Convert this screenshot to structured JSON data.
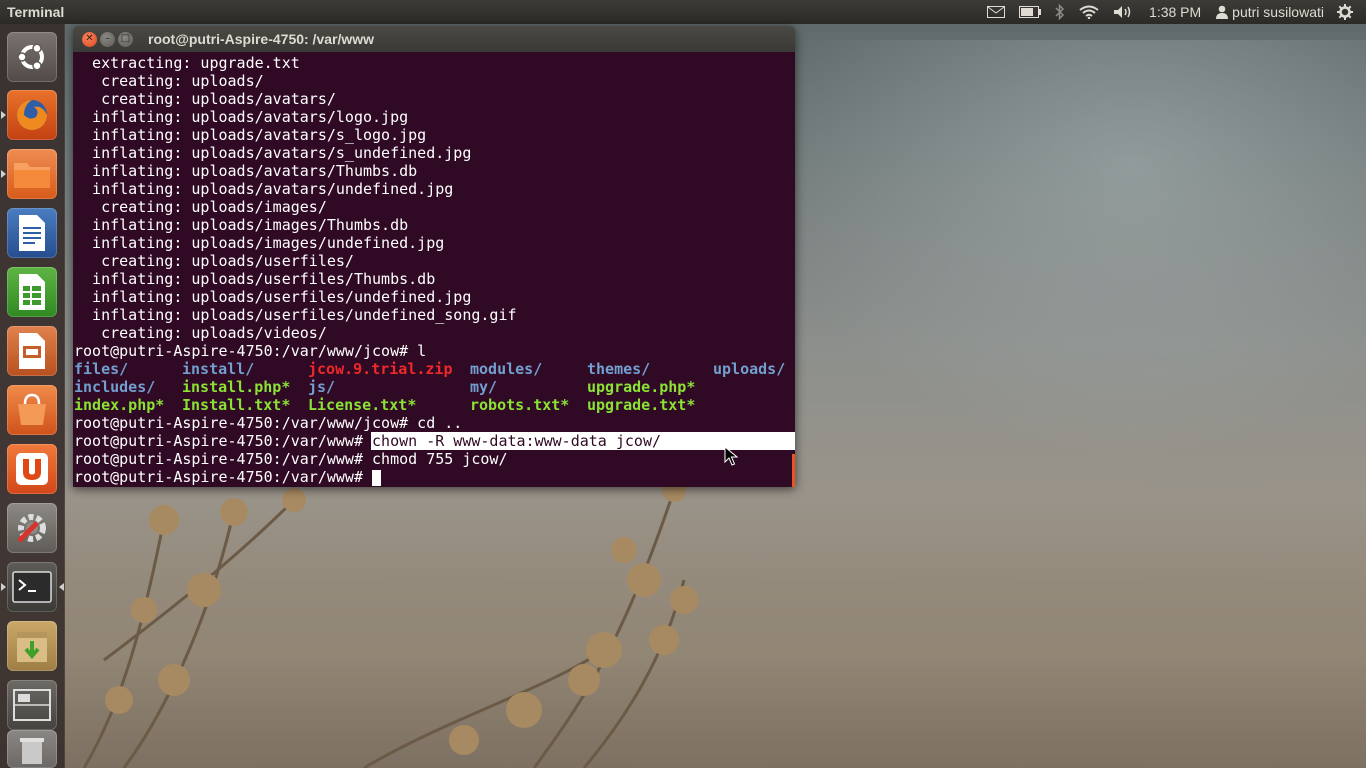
{
  "top_panel": {
    "app_title": "Terminal",
    "clock": "1:38 PM",
    "user_name": "putri susilowati"
  },
  "launcher": {
    "items": [
      {
        "name": "Dash home",
        "icon": "ubuntu-icon"
      },
      {
        "name": "Firefox",
        "icon": "firefox-icon"
      },
      {
        "name": "Files",
        "icon": "folder-icon"
      },
      {
        "name": "LibreOffice Writer",
        "icon": "writer-icon"
      },
      {
        "name": "LibreOffice Calc",
        "icon": "calc-icon"
      },
      {
        "name": "LibreOffice Impress",
        "icon": "impress-icon"
      },
      {
        "name": "Ubuntu Software Center",
        "icon": "software-center-icon"
      },
      {
        "name": "Ubuntu One",
        "icon": "ubuntu-one-icon"
      },
      {
        "name": "System Settings",
        "icon": "settings-icon"
      },
      {
        "name": "Terminal",
        "icon": "terminal-icon"
      },
      {
        "name": "Archive Manager",
        "icon": "archive-icon"
      },
      {
        "name": "Workspace Switcher",
        "icon": "workspace-icon"
      },
      {
        "name": "Trash",
        "icon": "trash-icon"
      }
    ]
  },
  "terminal": {
    "window_title": "root@putri-Aspire-4750: /var/www",
    "output_lines": [
      "  extracting: upgrade.txt",
      "   creating: uploads/",
      "   creating: uploads/avatars/",
      "  inflating: uploads/avatars/logo.jpg",
      "  inflating: uploads/avatars/s_logo.jpg",
      "  inflating: uploads/avatars/s_undefined.jpg",
      "  inflating: uploads/avatars/Thumbs.db",
      "  inflating: uploads/avatars/undefined.jpg",
      "   creating: uploads/images/",
      "  inflating: uploads/images/Thumbs.db",
      "  inflating: uploads/images/undefined.jpg",
      "   creating: uploads/userfiles/",
      "  inflating: uploads/userfiles/Thumbs.db",
      "  inflating: uploads/userfiles/undefined.jpg",
      "  inflating: uploads/userfiles/undefined_song.gif",
      "   creating: uploads/videos/",
      "root@putri-Aspire-4750:/var/www/jcow# l"
    ],
    "ls_listing": {
      "row1": [
        "files/",
        "install/",
        "jcow.9.trial.zip",
        "modules/",
        "themes/",
        "uploads/"
      ],
      "row2": [
        "includes/",
        "install.php*",
        "js/",
        "my/",
        "upgrade.php*"
      ],
      "row3": [
        "index.php*",
        "Install.txt*",
        "License.txt*",
        "robots.txt*",
        "upgrade.txt*"
      ]
    },
    "after_lines": {
      "cd_line": "root@putri-Aspire-4750:/var/www/jcow# cd ..",
      "chown_prompt": "root@putri-Aspire-4750:/var/www# ",
      "chown_cmd": "chown -R www-data:www-data jcow/",
      "chmod_line": "root@putri-Aspire-4750:/var/www# chmod 755 jcow/",
      "final_prompt": "root@putri-Aspire-4750:/var/www# "
    },
    "colors": {
      "background": "#300a24",
      "directory": "#729fcf",
      "archive": "#ef2929",
      "executable": "#8ae234"
    }
  }
}
